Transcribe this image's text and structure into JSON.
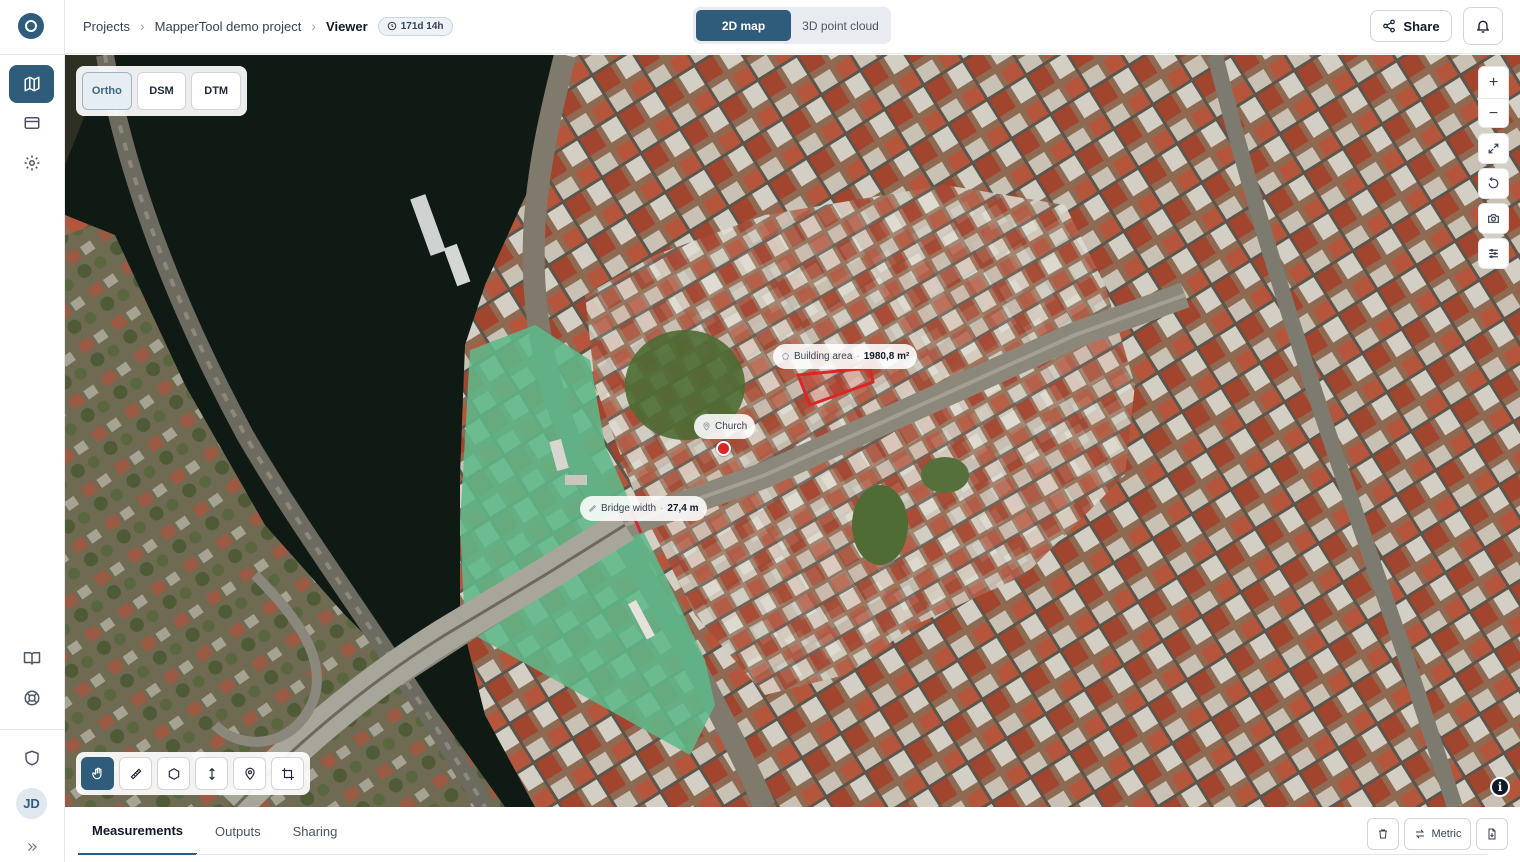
{
  "breadcrumb": {
    "items": [
      "Projects",
      "MapperTool demo project"
    ],
    "current": "Viewer",
    "time_badge": "171d 14h"
  },
  "view_toggle": {
    "options": [
      "2D map",
      "3D point cloud"
    ],
    "active": "2D map"
  },
  "header_actions": {
    "share_label": "Share"
  },
  "layers": {
    "options": [
      "Ortho",
      "DSM",
      "DTM"
    ],
    "active": "Ortho"
  },
  "map_labels": {
    "building": {
      "name": "Building area",
      "value": "1980,8 m²"
    },
    "church": {
      "name": "Church"
    },
    "bridge": {
      "name": "Bridge width",
      "value": "27,4 m"
    }
  },
  "zoom": {
    "in": "+",
    "out": "−"
  },
  "info_symbol": "i",
  "user": {
    "initials": "JD"
  },
  "bottom": {
    "tabs": [
      "Measurements",
      "Outputs",
      "Sharing"
    ],
    "active_tab": "Measurements",
    "units_label": "Metric"
  },
  "colors": {
    "accent": "#2f5c7a",
    "pin": "#dc2626",
    "water": "#0f1a14",
    "highlight_area": "#5fb88a"
  },
  "icons": {
    "rail": [
      "map-icon",
      "card-icon",
      "gear-icon",
      "book-icon",
      "lifebuoy-icon",
      "shield-icon"
    ],
    "tools": [
      "hand-icon",
      "ruler-icon",
      "polygon-icon",
      "height-icon",
      "pin-icon",
      "crop-icon"
    ],
    "map_controls": [
      "plus-icon",
      "minus-icon",
      "fullscreen-icon",
      "reset-icon",
      "camera-icon",
      "sliders-icon"
    ]
  }
}
